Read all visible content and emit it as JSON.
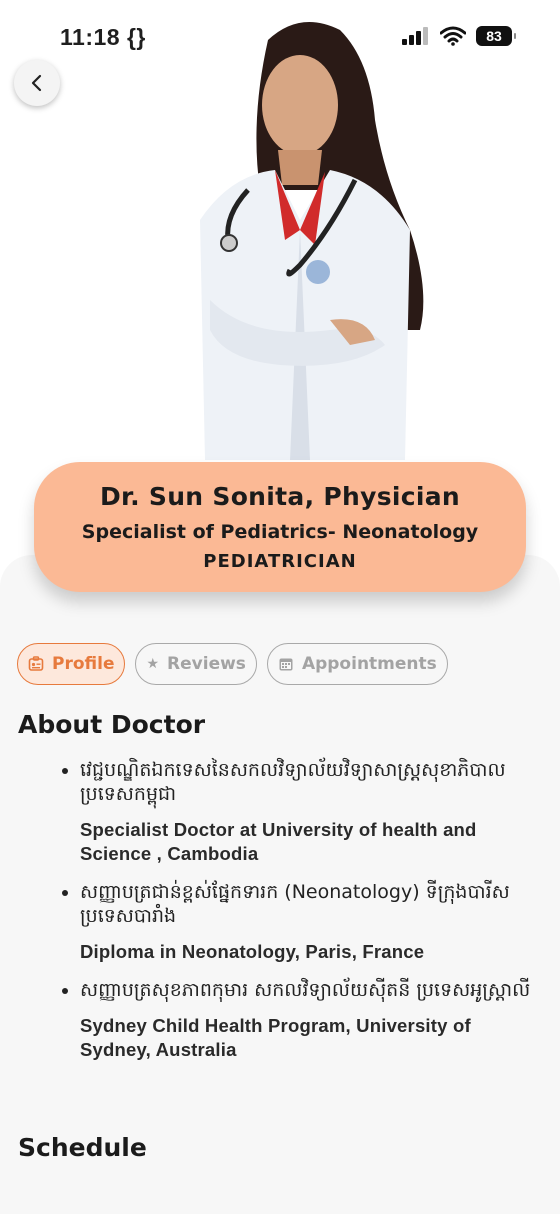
{
  "status": {
    "time": "11:18 {}",
    "battery": "83"
  },
  "doctor": {
    "name": "Dr. Sun Sonita, Physician",
    "specialty": "Specialist of Pediatrics- Neonatology",
    "role": "PEDIATRICIAN"
  },
  "tabs": [
    {
      "label": "Profile",
      "icon": "id-card-icon",
      "active": true
    },
    {
      "label": "Reviews",
      "icon": "star-icon",
      "active": false
    },
    {
      "label": "Appointments",
      "icon": "calendar-icon",
      "active": false
    }
  ],
  "about": {
    "title": "About Doctor",
    "items": [
      {
        "khmer": "វេជ្ជបណ្ឌិតឯកទេសនៃសកលវិទ្យាល័យវិទ្យាសាស្ត្រសុខាភិបាល ប្រទេសកម្ពុជា",
        "english": "Specialist Doctor at University of health and Science , Cambodia"
      },
      {
        "khmer": "សញ្ញាបត្រជាន់ខ្ពស់ផ្នែកទារក (Neonatology) ទីក្រុងបារីស ប្រទេសបារាំង",
        "english": "Diploma in Neonatology, Paris, France"
      },
      {
        "khmer": "សញ្ញាបត្រសុខភាពកុមារ សកលវិទ្យាល័យស៊ីតនី ប្រទេសអូស្ត្រាលី",
        "english": "Sydney Child Health Program, University of Sydney, Australia"
      }
    ]
  },
  "schedule": {
    "title": "Schedule"
  },
  "colors": {
    "accent": "#e77a3d",
    "card": "#fbb995",
    "background": "#f7f7f7"
  }
}
